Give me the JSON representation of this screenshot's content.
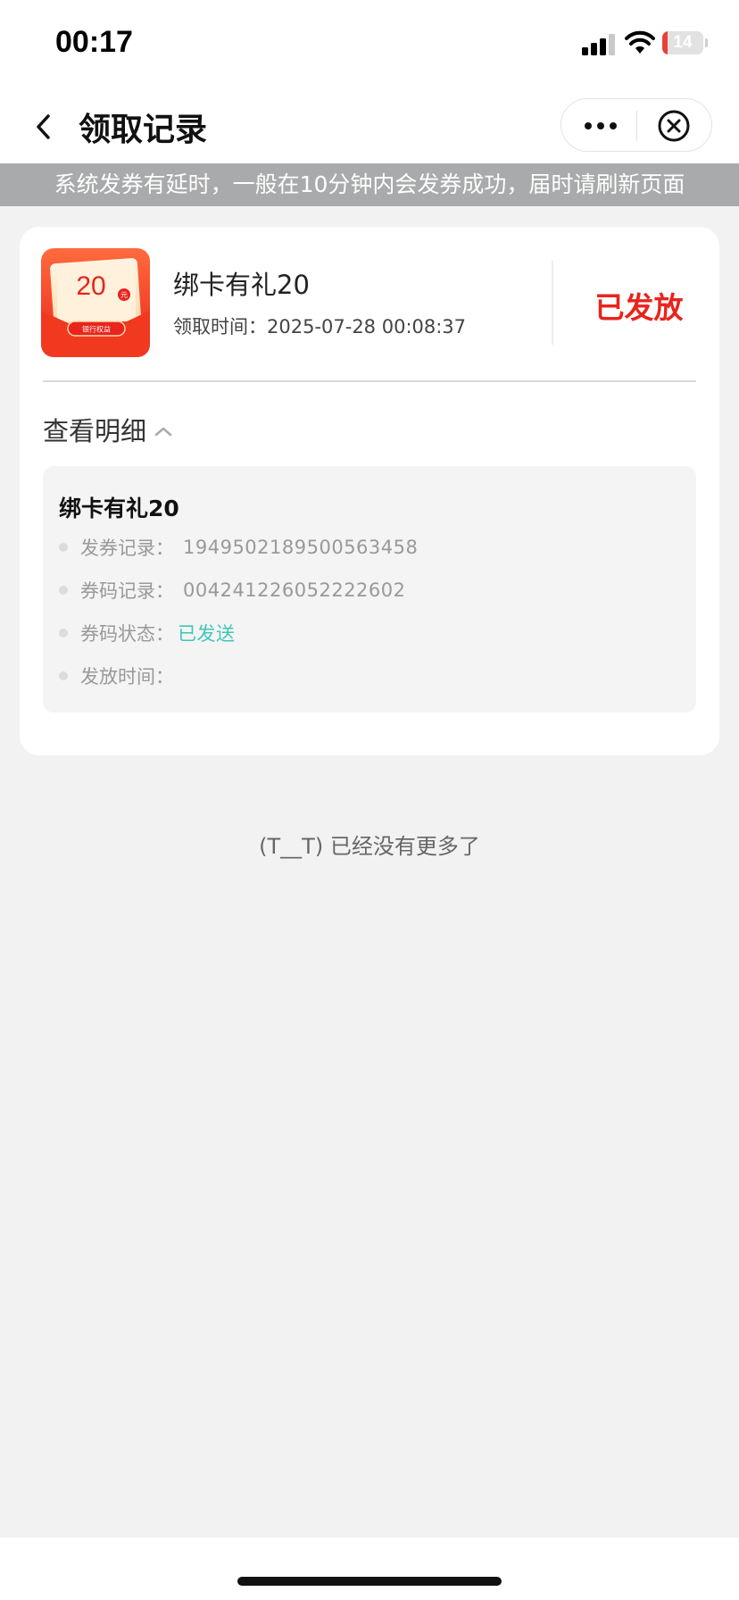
{
  "status_bar": {
    "time": "00:17",
    "battery_level": "14",
    "battery_fraction": 0.14,
    "battery_color": "#e8413b",
    "icons": [
      "signal-icon",
      "wifi-icon",
      "battery-icon"
    ]
  },
  "nav": {
    "title": "领取记录",
    "back_icon": "chevron-left-icon",
    "more_icon": "more-icon",
    "close_icon": "close-circle-icon"
  },
  "notice": {
    "text": "系统发券有延时，一般在10分钟内会发券成功，届时请刷新页面"
  },
  "record": {
    "thumb": {
      "amount": "20",
      "unit": "元",
      "button_label": "银行权益"
    },
    "title": "绑卡有礼20",
    "time_label": "领取时间：",
    "time_value": "2025-07-28 00:08:37",
    "status": "已发放",
    "status_color": "#e8241c",
    "detail_toggle": "查看明细",
    "detail": {
      "title": "绑卡有礼20",
      "rows": [
        {
          "label": "发券记录：",
          "value": "1949502189500563458"
        },
        {
          "label": "券码记录：",
          "value": "004241226052222602"
        },
        {
          "label": "券码状态：",
          "value": "已发送"
        },
        {
          "label": "发放时间：",
          "value": ""
        }
      ],
      "accent_color": "#41c6b4"
    }
  },
  "footer": {
    "end_text": "(T__T) 已经没有更多了"
  }
}
